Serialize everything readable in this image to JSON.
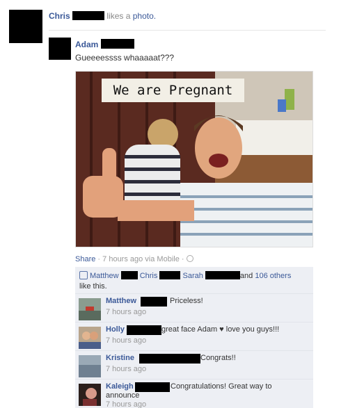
{
  "story": {
    "actor": "Chris",
    "verb": "likes a",
    "object": "photo."
  },
  "post": {
    "author": "Adam",
    "message": "Gueeeessss whaaaaat???",
    "photo_caption": "We are Pregnant"
  },
  "meta": {
    "share_label": "Share",
    "separator": "·",
    "time": "7 hours ago via Mobile",
    "globe_icon": "globe-icon"
  },
  "likes": {
    "names": [
      "Matthew",
      "Chris",
      "Sarah"
    ],
    "and_text": "and",
    "others_link": "106 others",
    "suffix": "like this."
  },
  "comments": [
    {
      "name": "Matthew",
      "text": "Priceless!",
      "time": "7 hours ago"
    },
    {
      "name": "Holly",
      "text": "great face Adam ♥ love you guys!!!",
      "time": "7 hours ago"
    },
    {
      "name": "Kristine",
      "text": "Congrats!!",
      "time": "7 hours ago"
    },
    {
      "name": "Kaleigh",
      "text": "Congratulations! Great way to",
      "text2": "announce",
      "time": "7 hours ago"
    }
  ],
  "colors": {
    "link": "#3b5998",
    "comment_bg": "#edeff4"
  }
}
